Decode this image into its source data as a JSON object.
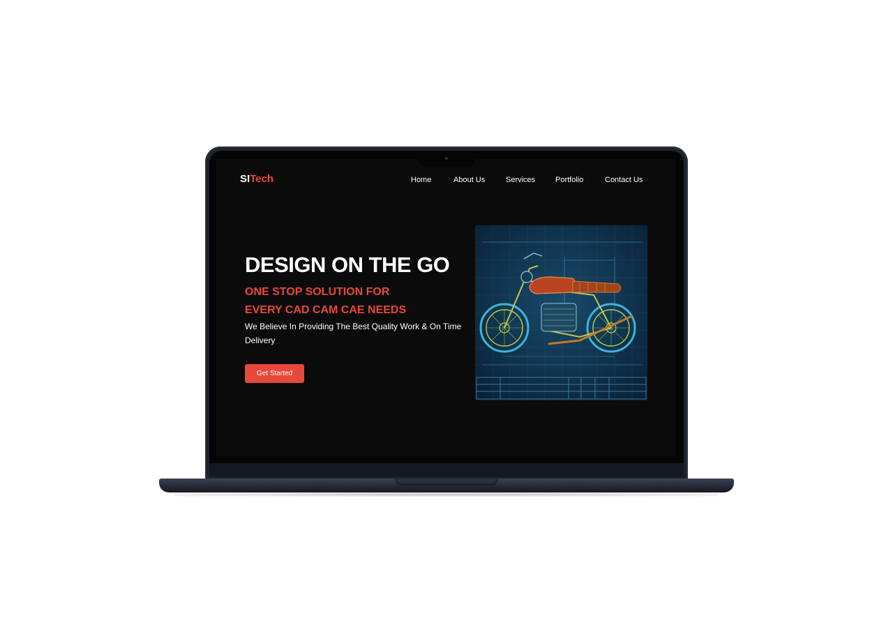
{
  "site": {
    "logo_part1": "SI",
    "logo_part2": "Tech"
  },
  "nav": {
    "items": [
      {
        "label": "Home"
      },
      {
        "label": "About Us"
      },
      {
        "label": "Services"
      },
      {
        "label": "Portfolio"
      },
      {
        "label": "Contact Us"
      }
    ]
  },
  "hero": {
    "title": "DESIGN ON THE GO",
    "subtitle_line1": "ONE STOP SOLUTION FOR",
    "subtitle_line2": "EVERY CAD CAM CAE NEEDS",
    "description": "We Believe In Providing The Best Quality Work & On Time Delivery",
    "cta_label": "Get Started"
  },
  "colors": {
    "accent": "#e8473c",
    "background": "#0b0b0c",
    "text": "#ffffff",
    "blueprint": "#0d2a40"
  },
  "image": {
    "subject": "motorcycle-blueprint"
  }
}
